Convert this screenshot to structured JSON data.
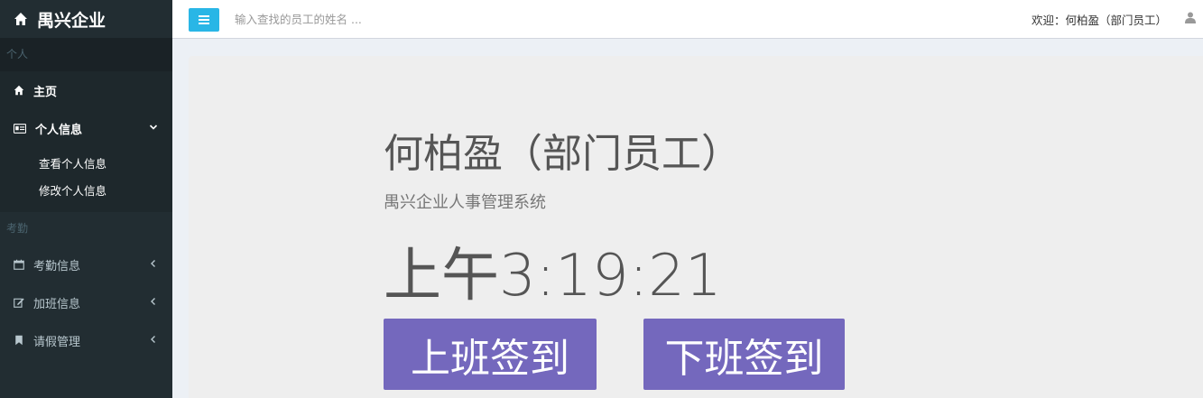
{
  "brand": {
    "title": "禺兴企业"
  },
  "sidebar": {
    "section_personal": "个人",
    "home": "主页",
    "personal_info": "个人信息",
    "personal_sub": [
      "查看个人信息",
      "修改个人信息"
    ],
    "section_attendance": "考勤",
    "attendance_info": "考勤信息",
    "overtime_info": "加班信息",
    "leave_mgmt": "请假管理"
  },
  "header": {
    "search_placeholder": "输入查找的员工的姓名 ...",
    "welcome": "欢迎：何柏盈（部门员工）"
  },
  "main": {
    "name": "何柏盈（部门员工）",
    "subtitle": "禺兴企业人事管理系统",
    "clock": "上午3:19:21",
    "checkin_label": "上班签到",
    "checkout_label": "下班签到"
  },
  "colors": {
    "sidebar": "#222d32",
    "button": "#7468bd",
    "toggle": "#29b6e6"
  }
}
